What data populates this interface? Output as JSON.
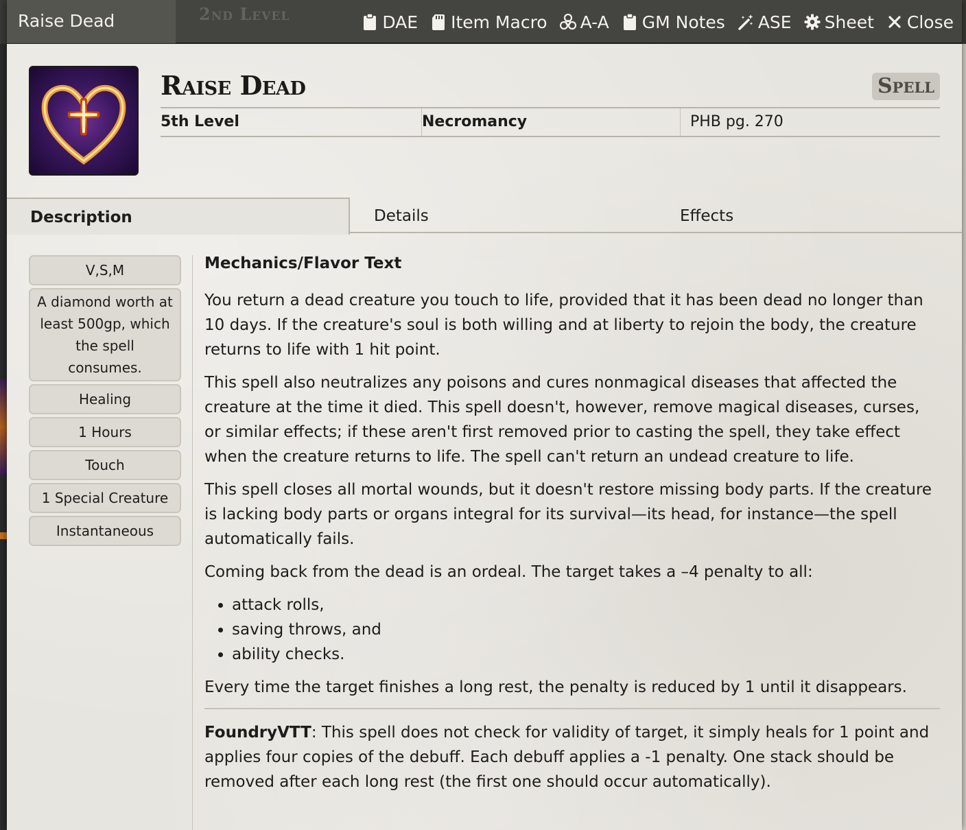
{
  "window": {
    "title": "Raise Dead",
    "ghost_text": "2nd Level",
    "controls": [
      {
        "label": "DAE",
        "icon": "clipboard-icon"
      },
      {
        "label": "Item Macro",
        "icon": "sd-card-icon"
      },
      {
        "label": "A-A",
        "icon": "biohazard-icon"
      },
      {
        "label": "GM Notes",
        "icon": "clipboard-icon"
      },
      {
        "label": "ASE",
        "icon": "magic-wand-icon"
      },
      {
        "label": "Sheet",
        "icon": "gear-icon"
      },
      {
        "label": "Close",
        "icon": "close-icon"
      }
    ]
  },
  "spell": {
    "name": "Raise Dead",
    "badge": "Spell",
    "level": "5th Level",
    "school": "Necromancy",
    "source": "PHB pg. 270"
  },
  "tabs": [
    {
      "label": "Description",
      "active": true
    },
    {
      "label": "Details",
      "active": false
    },
    {
      "label": "Effects",
      "active": false
    }
  ],
  "properties": [
    "V,S,M",
    "A diamond worth at least 500gp, which the spell consumes.",
    "Healing",
    "1 Hours",
    "Touch",
    "1 Special Creature",
    "Instantaneous"
  ],
  "description": {
    "heading": "Mechanics/Flavor Text",
    "paragraphs": [
      "You return a dead creature you touch to life, provided that it has been dead no longer than 10 days. If the creature's soul is both willing and at liberty to rejoin the body, the creature returns to life with 1 hit point.",
      "This spell also neutralizes any poisons and cures nonmagical diseases that affected the creature at the time it died. This spell doesn't, however, remove magical diseases, curses, or similar effects; if these aren't first removed prior to casting the spell, they take effect when the creature returns to life. The spell can't return an undead creature to life.",
      "This spell closes all mortal wounds, but it doesn't restore missing body parts. If the creature is lacking body parts or organs integral for its survival—its head, for instance—the spell automatically fails.",
      "Coming back from the dead is an ordeal. The target takes a –4 penalty to all:"
    ],
    "list": [
      "attack rolls,",
      "saving throws, and",
      "ability checks."
    ],
    "closing": "Every time the target finishes a long rest, the penalty is reduced by 1 until it disappears.",
    "note_label": "FoundryVTT",
    "note_text": ": This spell does not check for validity of target, it simply heals for 1 point and applies four copies of the debuff.  Each debuff applies a -1 penalty.  One stack should be removed after each long rest (the first one should occur automatically)."
  },
  "colors": {
    "header_bg": "#444440",
    "sheet_bg": "#e7e5df",
    "prop_bg": "#dcdad3"
  }
}
